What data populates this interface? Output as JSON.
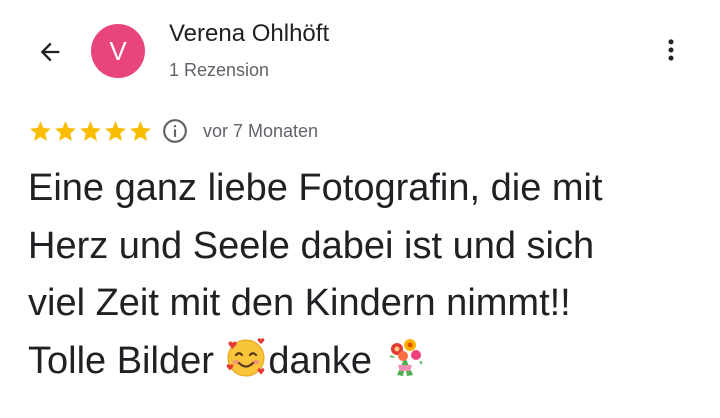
{
  "header": {
    "back_icon": "arrow-back-icon",
    "menu_icon": "more-vert-icon",
    "avatar_letter": "V",
    "avatar_color": "#e8457c",
    "user_name": "Verena Ohlhöft",
    "user_meta": "1 Rezension"
  },
  "rating": {
    "stars": 5,
    "max_stars": 5,
    "star_color": "#fbbc04",
    "info_icon": "info-icon",
    "date": "vor 7 Monaten"
  },
  "review": {
    "lines": [
      "Eine ganz liebe Fotografin, die mit",
      "Herz und Seele dabei ist und sich",
      "viel Zeit mit den Kindern nimmt!!"
    ],
    "last_line_start": "Tolle Bilder ",
    "smiling_face_with_hearts_emoji": "smiling-face-with-hearts-emoji",
    "last_line_mid": "danke ",
    "bouquet_emoji": "bouquet-emoji"
  }
}
